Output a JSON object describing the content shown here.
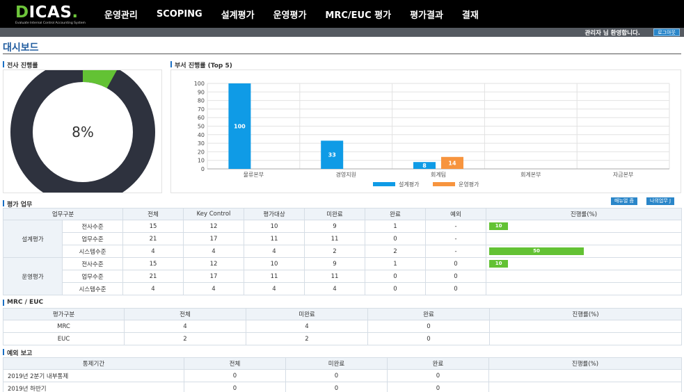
{
  "app": {
    "logo": "DICAS.",
    "logo_d": "D",
    "logo_rest": "ICAS",
    "logo_dot": ".",
    "logo_sub": "Evaluate Internal Control Accounting System"
  },
  "nav": [
    "운영관리",
    "SCOPING",
    "설계평가",
    "운영평가",
    "MRC/EUC 평가",
    "평가결과",
    "결재"
  ],
  "userbar": {
    "welcome": "관리자 님 환영합니다.",
    "logout": "로그아웃"
  },
  "page_title": "대시보드",
  "overall": {
    "section_title": "전사 진행률",
    "percent_label": "8%",
    "percent": 8,
    "colors": {
      "progress": "#63c234",
      "remainder": "#2e323e"
    }
  },
  "dept": {
    "section_title": "부서 진행률 (Top 5)"
  },
  "chart_data": {
    "type": "bar",
    "categories": [
      "물류본부",
      "경영지원",
      "회계팀",
      "회계본부",
      "자금본부"
    ],
    "series": [
      {
        "name": "설계평가",
        "values": [
          100,
          33,
          8,
          null,
          null
        ],
        "color": "#0f9be6"
      },
      {
        "name": "운영평가",
        "values": [
          null,
          null,
          14,
          null,
          null
        ],
        "color": "#f7943e"
      }
    ],
    "ylim": [
      0,
      100
    ],
    "yticks": [
      0,
      10,
      20,
      30,
      40,
      50,
      60,
      70,
      80,
      90,
      100
    ],
    "legend": "bottom",
    "grid": true
  },
  "eval": {
    "section_title": "평가 업무",
    "manual_btn": "매뉴얼 즘",
    "my_tasks_btn": "나의업무 J",
    "headers": [
      "업무구분",
      "전체",
      "Key Control",
      "평가대상",
      "미완료",
      "완료",
      "예외",
      "진행률(%)"
    ],
    "groups": [
      {
        "label": "설계평가",
        "rows": [
          {
            "sub": "전사수준",
            "total": "15",
            "key": "12",
            "target": "10",
            "incomplete": "9",
            "complete": "1",
            "exception": "-",
            "progress": 10,
            "progress_label": "10"
          },
          {
            "sub": "업무수준",
            "total": "21",
            "key": "17",
            "target": "11",
            "incomplete": "11",
            "complete": "0",
            "exception": "-",
            "progress": 0,
            "progress_label": ""
          },
          {
            "sub": "시스템수준",
            "total": "4",
            "key": "4",
            "target": "4",
            "incomplete": "2",
            "complete": "2",
            "exception": "-",
            "progress": 50,
            "progress_label": "50"
          }
        ]
      },
      {
        "label": "운영평가",
        "rows": [
          {
            "sub": "전사수준",
            "total": "15",
            "key": "12",
            "target": "10",
            "incomplete": "9",
            "complete": "1",
            "exception": "0",
            "progress": 10,
            "progress_label": "10"
          },
          {
            "sub": "업무수준",
            "total": "21",
            "key": "17",
            "target": "11",
            "incomplete": "11",
            "complete": "0",
            "exception": "0",
            "progress": 0,
            "progress_label": ""
          },
          {
            "sub": "시스템수준",
            "total": "4",
            "key": "4",
            "target": "4",
            "incomplete": "4",
            "complete": "0",
            "exception": "0",
            "progress": 0,
            "progress_label": ""
          }
        ]
      }
    ]
  },
  "mrc": {
    "section_title": "MRC / EUC",
    "headers": [
      "평가구분",
      "전체",
      "미완료",
      "완료",
      "진행률(%)"
    ],
    "rows": [
      {
        "label": "MRC",
        "total": "4",
        "incomplete": "4",
        "complete": "0"
      },
      {
        "label": "EUC",
        "total": "2",
        "incomplete": "2",
        "complete": "0"
      }
    ]
  },
  "exception": {
    "section_title": "예외 보고",
    "headers": [
      "통제기간",
      "전체",
      "미완료",
      "완료",
      "진행률(%)"
    ],
    "rows": [
      {
        "label": "2019년 2분기 내부통제",
        "total": "0",
        "incomplete": "0",
        "complete": "0"
      },
      {
        "label": "2019년 하반기",
        "total": "0",
        "incomplete": "0",
        "complete": "0"
      }
    ]
  }
}
